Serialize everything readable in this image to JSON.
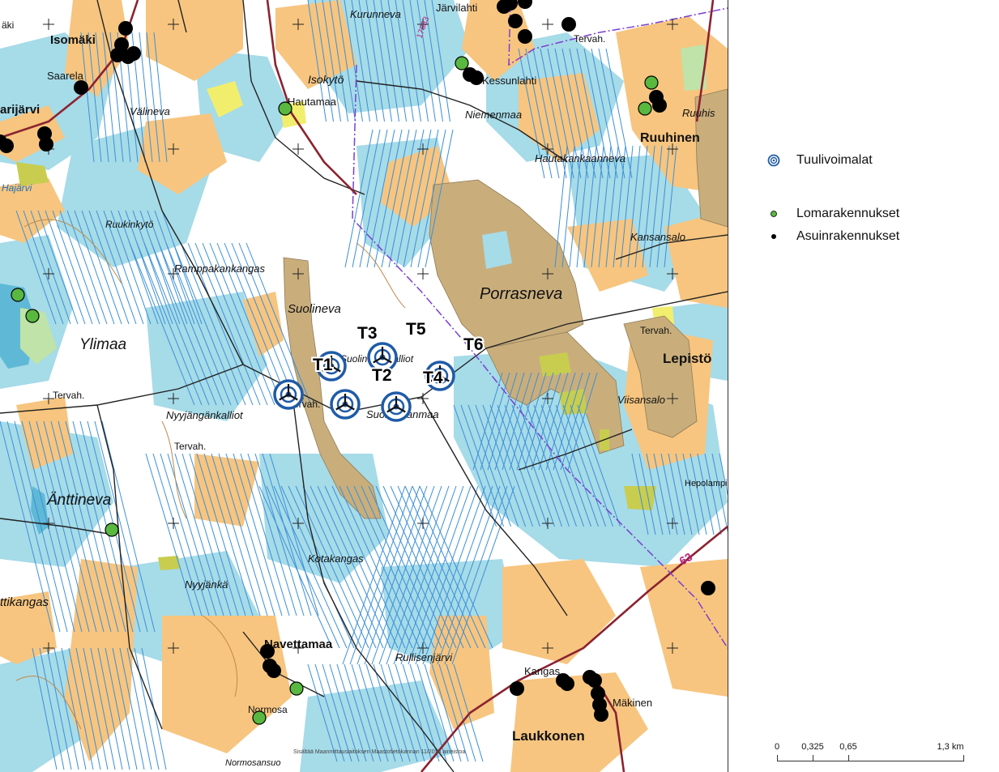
{
  "legend": {
    "turbines": "Tuulivoimalat",
    "holiday": "Lomarakennukset",
    "residential": "Asuinrakennukset"
  },
  "colors": {
    "water": "#a6dbe8",
    "field": "#f7c57f",
    "peat": "#c9ae7c",
    "ditch": "#3b8fd9",
    "road": "#8b2330",
    "holiday": "#58b83f",
    "residential": "#000000",
    "turbine": "#1f5ba8",
    "boundary": "#7a3fd0"
  },
  "scalebar": {
    "ticks": [
      "0",
      "0,325",
      "0,65",
      "1,3 km"
    ]
  },
  "copyright": "Sisältää Maanmittauslaitoksen Maastotietokannan 11/2014 aineistoa",
  "turbines": [
    {
      "label": "T1"
    },
    {
      "label": "T2"
    },
    {
      "label": "T3"
    },
    {
      "label": "T4"
    },
    {
      "label": "T5"
    },
    {
      "label": "T6"
    }
  ],
  "places": {
    "isomaki": "Isomäki",
    "saarela": "Saarela",
    "karijarvi": "arijärvi",
    "valineva": "Välineva",
    "kurunneva": "Kurunneva",
    "jarvilahti": "Järvilahti",
    "tervah_ne": "Tervah.",
    "isokyto": "Isokytö",
    "hautamaa": "Hautamaa",
    "kessunlahti": "Kessunlahti",
    "niemenmaa": "Niemenmaa",
    "ruuhis": "Ruuhis",
    "ruuhinen": "Ruuhinen",
    "hautakankaanneva": "Hautakankaanneva",
    "ruukinkyto": "Ruukinkytö",
    "kansansalo": "Kansansalo",
    "ramppakankangas": "Ramppakankangas",
    "porrasneva": "Porrasneva",
    "suolineva": "Suolineva",
    "ylimaa": "Ylimaa",
    "tervah_w": "Tervah.",
    "tervah_c": "Tervah.",
    "tervah_e": "Tervah.",
    "lepisto": "Lepistö",
    "suolinevankalliot": "Suolinevankalliot",
    "viisansalo": "Viisansalo",
    "nyyjangankalliot": "Nyyjängänkalliot",
    "suolinevanmaa": "Suolinevanmaa",
    "tervah_sw": "Tervah.",
    "hepolampi": "Hepolampi",
    "anttineva": "Änttineva",
    "kotakangas": "Kotakangas",
    "ttikangas": "ttikangas",
    "nyyjanka": "Nyyjänkä",
    "navettamaa": "Navettamaa",
    "rullisenjarvi": "Rullisenjärvi",
    "kangas": "Kangas",
    "makinen": "Mäkinen",
    "normosa": "Normosa",
    "laukkonen": "Laukkonen",
    "normosansuo": "Normosansuo",
    "hajarvi": "Hajärvi",
    "road_17883": "17883",
    "road_63": "63",
    "aki": "äki"
  }
}
